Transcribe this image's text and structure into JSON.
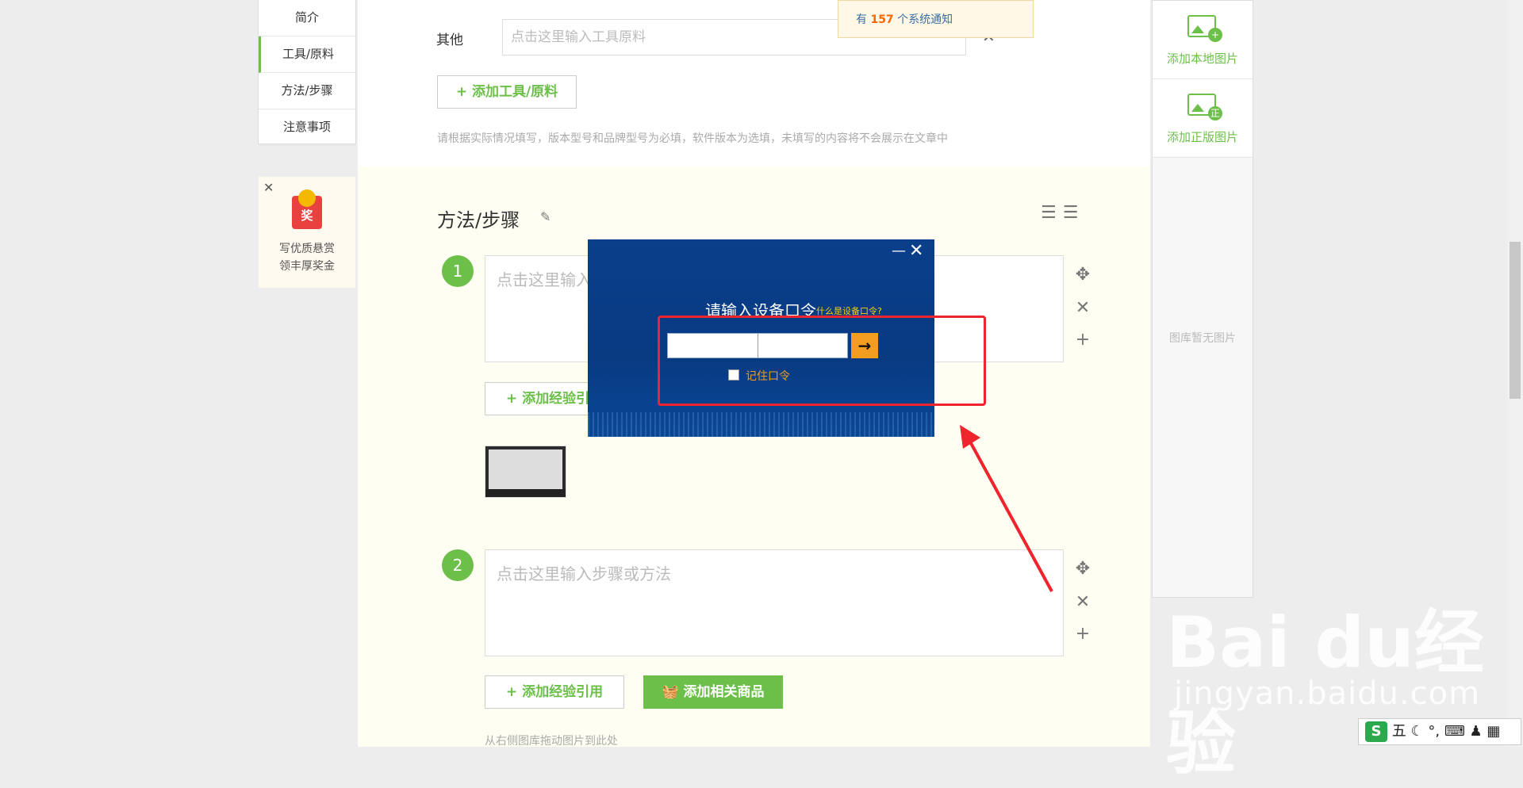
{
  "left_nav": {
    "items": [
      {
        "label": "简介"
      },
      {
        "label": "工具/原料"
      },
      {
        "label": "方法/步骤"
      },
      {
        "label": "注意事项"
      }
    ]
  },
  "promo": {
    "badge": "奖",
    "line1": "写优质悬赏",
    "line2": "领丰厚奖金"
  },
  "tools": {
    "other_label": "其他",
    "other_placeholder": "点击这里输入工具原料",
    "add_button": "+ 添加工具/原料",
    "hint": "请根据实际情况填写，版本型号和品牌型号为必填，软件版本为选填，未填写的内容将不会展示在文章中"
  },
  "steps": {
    "title": "方法/步骤",
    "items": [
      {
        "number": "1",
        "placeholder": "点击这里输入"
      },
      {
        "number": "2",
        "placeholder": "点击这里输入步骤或方法"
      }
    ],
    "add_ref": "+ 添加经验引用",
    "add_goods": "添加相关商品",
    "drag_hint": "从右侧图库拖动图片到此处"
  },
  "right_sidebar": {
    "add_local": "添加本地图片",
    "add_licensed": "添加正版图片",
    "licensed_badge": "正",
    "empty": "图库暂无图片"
  },
  "notice": {
    "prefix": "有",
    "count": "157",
    "suffix": "个系统通知"
  },
  "dialog": {
    "title": "请输入设备口令",
    "help_link": "什么是设备口令?",
    "password_value": "",
    "remember_label": "记住口令"
  },
  "watermark": {
    "brand": "Bai  du经验",
    "url": "jingyan.baidu.com"
  },
  "ime": {
    "logo": "S",
    "mode": "五"
  },
  "colors": {
    "accent_green": "#6cc04a",
    "dialog_blue": "#0a3f8a",
    "annotation_red": "#f0242d",
    "go_orange": "#f29d1f"
  }
}
